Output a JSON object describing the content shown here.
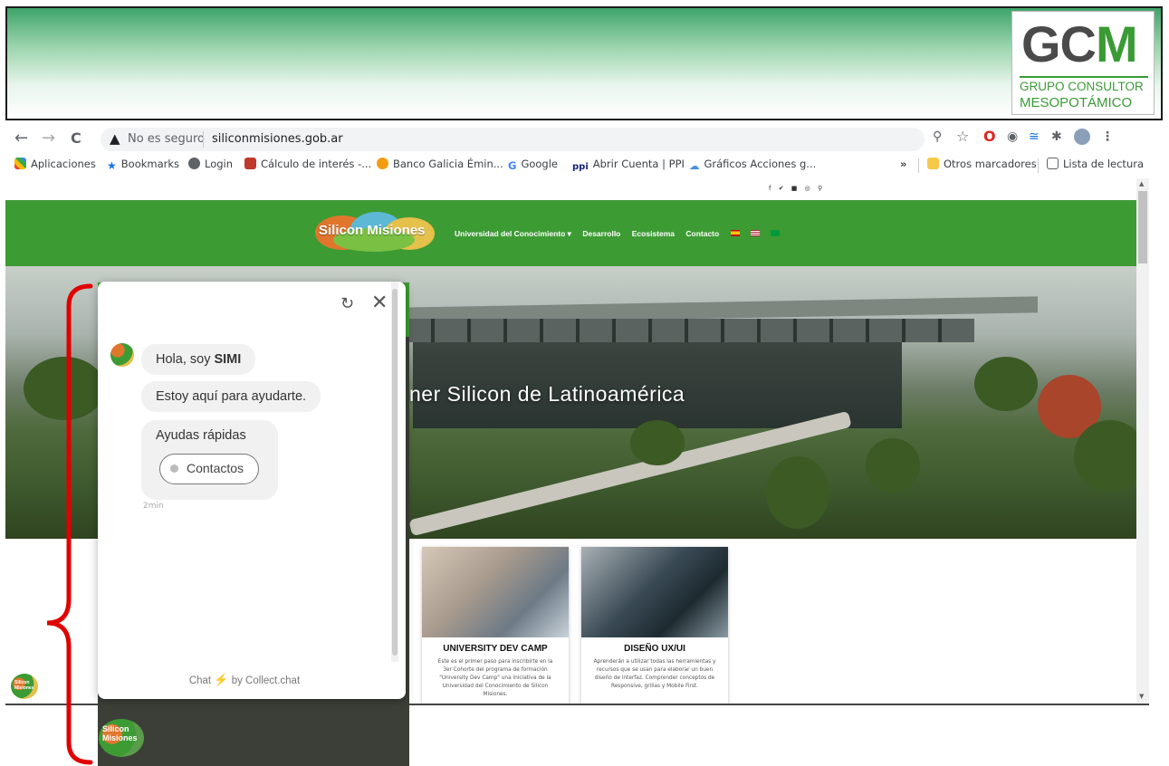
{
  "banner": {
    "logo_letters_gc": "GC",
    "logo_letter_m": "M",
    "logo_line1": "GRUPO CONSULTOR",
    "logo_line2": "MESOPOTÁMICO"
  },
  "browser": {
    "back_icon": "←",
    "forward_icon": "→",
    "reload_icon": "C",
    "security_label": "No es seguro",
    "url": "siliconmisiones.gob.ar",
    "bookmarks": [
      {
        "label": "Aplicaciones",
        "color": "#e8453c"
      },
      {
        "label": "Bookmarks",
        "color": "#1a73e8"
      },
      {
        "label": "Login",
        "color": "#5f6368"
      },
      {
        "label": "Cálculo de interés -...",
        "color": "#c0392b"
      },
      {
        "label": "Banco Galicia Émin...",
        "color": "#f39c12"
      },
      {
        "label": "Google",
        "color": "#4285f4"
      },
      {
        "label": "Abrir Cuenta | PPI",
        "color": "#1a237e"
      },
      {
        "label": "Gráficos Acciones g...",
        "color": "#4a90d9"
      }
    ],
    "more_bookmarks": "»",
    "other_bookmarks": "Otros marcadores",
    "reading_list": "Lista de lectura"
  },
  "site": {
    "logo_text": "Silicon Misiones",
    "menu": [
      "Universidad del Conocimiento ▾",
      "Desarrollo",
      "Ecosistema",
      "Contacto"
    ],
    "hero_text": "ner Silicon de Latinoamérica",
    "cards": [
      {
        "title": "UNIVERSITY DEV CAMP",
        "description": "Este es el primer paso para inscribirte en la 3er Cohorte del programa de formación \"University Dev Camp\" una iniciativa de la Universidad del Conocimiento de Silicon Misiones."
      },
      {
        "title": "DISEÑO UX/UI",
        "description": "Aprenderán a utilizar todas las herramientas y recursos que se usan para elaborar un buen diseño de interfaz. Comprender conceptos de Responsive, grillas y Mobile First."
      }
    ]
  },
  "chat": {
    "greeting_prefix": "Hola, soy ",
    "bot_name": "SIMI",
    "help_message": "Estoy aquí para ayudarte.",
    "quick_title": "Ayudas rápidas",
    "quick_option": "Contactos",
    "timestamp": "2min",
    "footer_prefix": "Chat",
    "footer_suffix": "by Collect.chat",
    "launcher_text_line1": "Silicon",
    "launcher_text_line2": "Misiones"
  },
  "colors": {
    "site_green": "#3d9b34",
    "annotation_red": "#e00000",
    "gcm_green": "#3a9b35"
  }
}
